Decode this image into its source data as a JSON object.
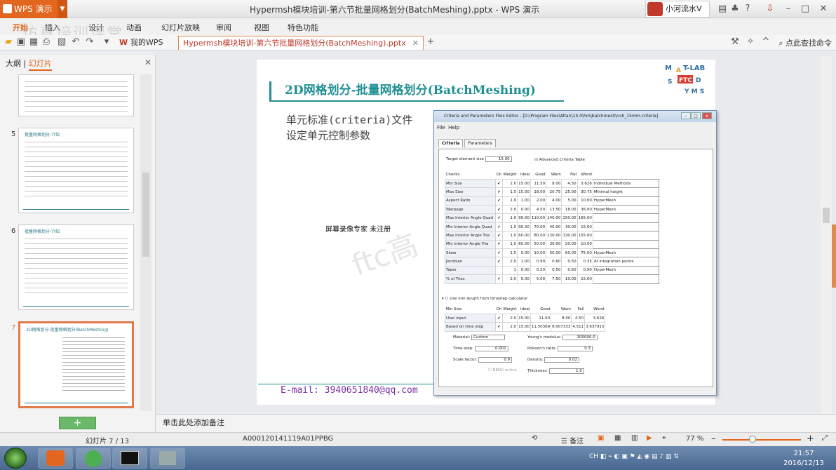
{
  "window": {
    "app_button": "WPS 演示",
    "doc_title": "Hypermsh模块培训-第六节批量网格划分(BatchMeshing).pptx - WPS 演示",
    "user": "小河流水V"
  },
  "menu": [
    "开始",
    "插入",
    "设计",
    "动画",
    "幻灯片放映",
    "审阅",
    "视图",
    "特色功能"
  ],
  "watermark": "仿真培训课堂",
  "tabs": {
    "wps": "我的WPS",
    "doc": "Hypermsh模块培训-第六节批量网格划分(BatchMeshing).pptx"
  },
  "find": "点此查找命令",
  "panel": {
    "outline_tab": "大纲",
    "slides_tab": "幻灯片"
  },
  "thumbs": [
    {
      "num": "5",
      "title": "批量网格划分-介绍"
    },
    {
      "num": "6",
      "title": "批量网格划分-介绍"
    },
    {
      "num": "7",
      "title": "2D网格划分-批量网格划分(BatchMeshing)"
    }
  ],
  "add_slide": "+",
  "slide": {
    "title": "2D网格划分-批量网格划分(BatchMeshing)",
    "sub1": "单元标准(criteria)文件",
    "sub2": "设定单元控制参数",
    "register": "屏幕录像专家 未注册",
    "watermark": "ftc高",
    "email": "E-mail: 3940651840@qq.com",
    "logo": "MATLAB FTC ANSYS"
  },
  "dialog": {
    "title": "Criteria and Parameters Files Editor - [D:\\Program Files\\Altair\\14.0\\hm\\batchmesh\\nvh_15mm.criteria]",
    "menu": [
      "File",
      "Help"
    ],
    "tabs": [
      "Criteria",
      "Parameters"
    ],
    "target_label": "Target element size",
    "target_value": "15.00",
    "advanced": "Advanced Criteria Table",
    "headers": [
      "Checks",
      "On",
      "Weight",
      "Ideal",
      "Good",
      "Warn",
      "Fail",
      "Worst",
      ""
    ],
    "rows": [
      [
        "Min Size",
        "✔",
        "2.0",
        "15.00",
        "11.50",
        "8.00",
        "4.50",
        "3.626",
        "Individual Methods"
      ],
      [
        "Max Size",
        "✔",
        "1.5",
        "15.00",
        "18.00",
        "20.75",
        "25.00",
        "30.75",
        "Minimal height"
      ],
      [
        "Aspect Ratio",
        "✔",
        "1.0",
        "1.00",
        "2.00",
        "4.00",
        "5.00",
        "10.00",
        "HyperMesh"
      ],
      [
        "Warpage",
        "✔",
        "2.0",
        "0.00",
        "4.50",
        "13.50",
        "18.00",
        "36.00",
        "HyperMesh"
      ],
      [
        "Max Interior Angle Quad",
        "✔",
        "1.0",
        "90.00",
        "110.00",
        "140.00",
        "150.00",
        "165.00",
        ""
      ],
      [
        "Min Interior Angle Quad",
        "✔",
        "1.0",
        "90.00",
        "70.00",
        "40.00",
        "30.00",
        "15.00",
        ""
      ],
      [
        "Max Interior Angle Tria",
        "✔",
        "1.0",
        "60.00",
        "80.00",
        "120.00",
        "130.00",
        "155.00",
        ""
      ],
      [
        "Min Interior Angle Tria",
        "✔",
        "1.0",
        "60.00",
        "50.00",
        "30.00",
        "20.00",
        "10.00",
        ""
      ],
      [
        "Skew",
        "✔",
        "1.5",
        "0.00",
        "10.00",
        "50.00",
        "60.00",
        "75.00",
        "HyperMesh"
      ],
      [
        "Jacobian",
        "✔",
        "2.0",
        "1.00",
        "0.90",
        "0.60",
        "0.50",
        "0.35",
        "At integration points"
      ],
      [
        "Taper",
        "",
        "1",
        "0.00",
        "0.20",
        "0.50",
        "0.60",
        "0.90",
        "HyperMesh"
      ],
      [
        "% of Trias",
        "✔",
        "2.0",
        "0.00",
        "5.00",
        "7.50",
        "10.00",
        "15.00",
        ""
      ]
    ],
    "timestep_label": "Use min length from timestep calculator",
    "headers2": [
      "Min Size",
      "On",
      "Weight",
      "Ideal",
      "Good",
      "Warn",
      "Fail",
      "Worst"
    ],
    "rows2": [
      [
        "User input",
        "✔",
        "2.0",
        "15.00",
        "11.50",
        "8.00",
        "4.50",
        "3.626"
      ],
      [
        "Based on time step",
        "✔",
        "2.0",
        "15.00",
        "11.50369",
        "8.007333",
        "4.511",
        "3.637915"
      ]
    ],
    "material_label": "Material:",
    "material_value": "Custom",
    "youngs_label": "Young's modulus:",
    "youngs_value": "300000.0",
    "timestep2_label": "Time step:",
    "timestep2_value": "0.001",
    "poisson_label": "Poisson's ratio:",
    "poisson_value": "0.3",
    "scale_label": "Scale factor:",
    "scale_value": "0.9",
    "density_label": "Density:",
    "density_value": "0.02",
    "bend_label": "BEND active",
    "thickness_label": "Thickness:",
    "thickness_value": "1.0"
  },
  "notes": "单击此处添加备注",
  "status": {
    "slide": "幻灯片 7 / 13",
    "id": "A000120141119A01PPBG",
    "notes": "备注",
    "zoom": "77 %"
  },
  "clock": {
    "time": "21:57",
    "date": "2016/12/13"
  },
  "colors": {
    "accent": "#e2661d",
    "title": "#1f8f93",
    "email": "#7b2fa0"
  }
}
